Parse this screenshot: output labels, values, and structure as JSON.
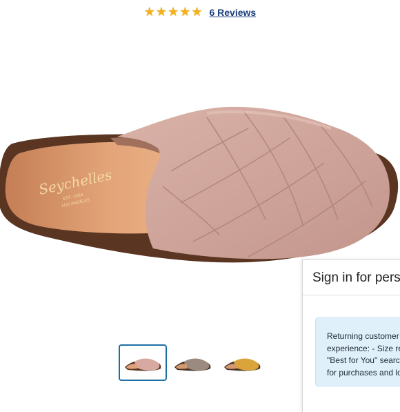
{
  "rating": {
    "stars": 5,
    "star_icons": [
      "star-filled-icon",
      "star-filled-icon",
      "star-filled-icon",
      "star-filled-icon",
      "star-filled-icon"
    ],
    "reviews_link": "6 Reviews",
    "star_color": "#f3b21b"
  },
  "product": {
    "image_name": "suede-mule-main-image",
    "insole_brand": "Seychelles",
    "insole_subtext": [
      "EST. 1984",
      "LOS ANGELES"
    ]
  },
  "thumbnails": [
    {
      "name": "thumbnail-blush",
      "color": "#d7a9a0",
      "selected": true
    },
    {
      "name": "thumbnail-taupe",
      "color": "#9a8a80",
      "selected": false
    },
    {
      "name": "thumbnail-mustard",
      "color": "#dba43a",
      "selected": false
    }
  ],
  "signin": {
    "title": "Sign in for perso",
    "message_lines": [
      "Returning customer",
      "experience: - Size re",
      "\"Best for You\" searc",
      "for purchases and lo"
    ],
    "info_box_color": "#dff0fb"
  }
}
